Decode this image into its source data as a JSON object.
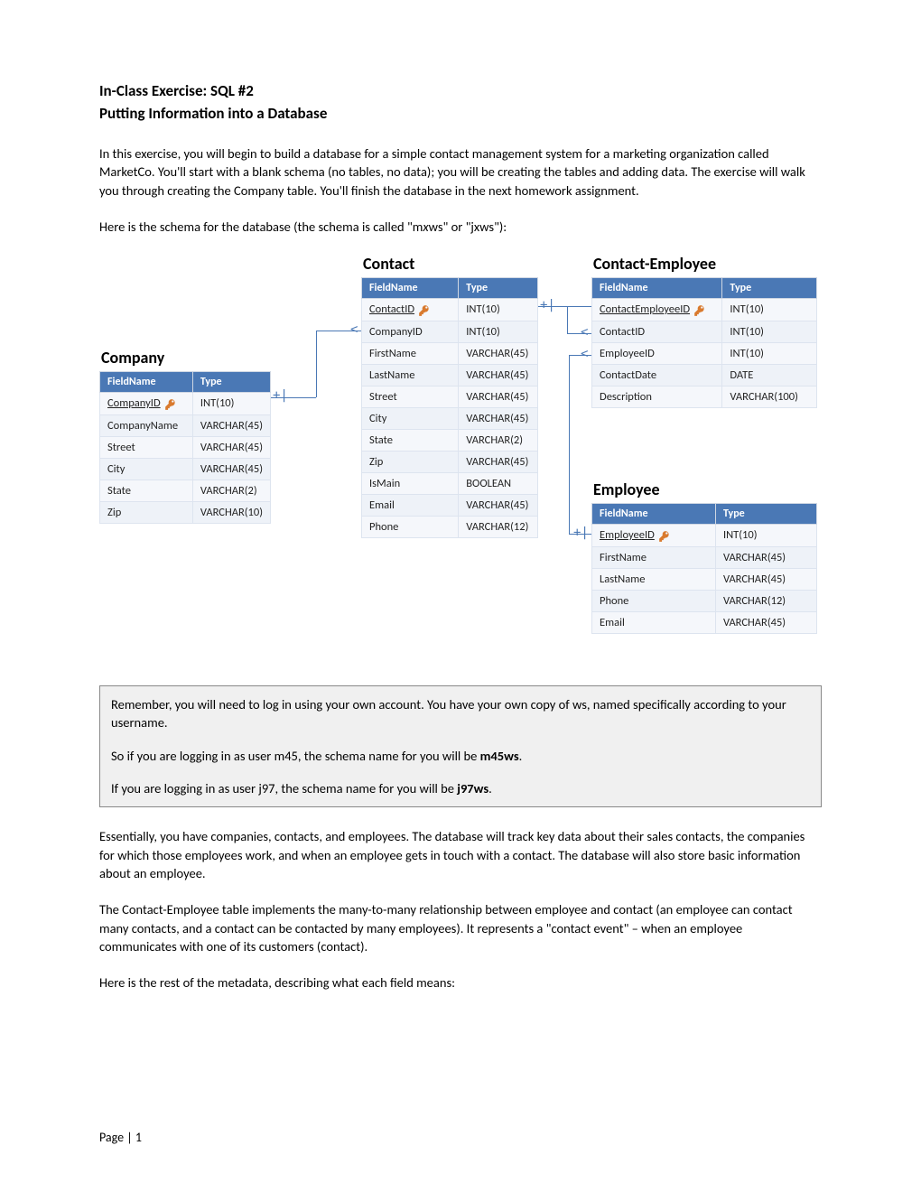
{
  "title": "In-Class Exercise: SQL #2",
  "subtitle": "Putting Information into a Database",
  "intro1": "In this exercise, you will begin to build a database for a simple contact management system for a marketing organization called MarketCo. You'll start with a blank schema (no tables, no data); you will be creating the tables and adding data. The exercise will walk you through creating the Company table. You'll finish the database in the next homework assignment.",
  "schema_lead_a": "Here is the schema for the database (the schema is called \"m",
  "schema_lead_b": "x",
  "schema_lead_c": "ws\" or \"jxws\"):",
  "tables": {
    "company": {
      "title": "Company",
      "headers": [
        "FieldName",
        "Type"
      ],
      "rows": [
        [
          "CompanyID",
          "INT(10)",
          true
        ],
        [
          "CompanyName",
          "VARCHAR(45)",
          false
        ],
        [
          "Street",
          "VARCHAR(45)",
          false
        ],
        [
          "City",
          "VARCHAR(45)",
          false
        ],
        [
          "State",
          "VARCHAR(2)",
          false
        ],
        [
          "Zip",
          "VARCHAR(10)",
          false
        ]
      ]
    },
    "contact": {
      "title": "Contact",
      "headers": [
        "FieldName",
        "Type"
      ],
      "rows": [
        [
          "ContactID",
          "INT(10)",
          true
        ],
        [
          "CompanyID",
          "INT(10)",
          false
        ],
        [
          "FirstName",
          "VARCHAR(45)",
          false
        ],
        [
          "LastName",
          "VARCHAR(45)",
          false
        ],
        [
          "Street",
          "VARCHAR(45)",
          false
        ],
        [
          "City",
          "VARCHAR(45)",
          false
        ],
        [
          "State",
          "VARCHAR(2)",
          false
        ],
        [
          "Zip",
          "VARCHAR(45)",
          false
        ],
        [
          "IsMain",
          "BOOLEAN",
          false
        ],
        [
          "Email",
          "VARCHAR(45)",
          false
        ],
        [
          "Phone",
          "VARCHAR(12)",
          false
        ]
      ]
    },
    "contact_employee": {
      "title": "Contact-Employee",
      "headers": [
        "FieldName",
        "Type"
      ],
      "rows": [
        [
          "ContactEmployeeID",
          "INT(10)",
          true
        ],
        [
          "ContactID",
          "INT(10)",
          false
        ],
        [
          "EmployeeID",
          "INT(10)",
          false
        ],
        [
          "ContactDate",
          "DATE",
          false
        ],
        [
          "Description",
          "VARCHAR(100)",
          false
        ]
      ]
    },
    "employee": {
      "title": "Employee",
      "headers": [
        "FieldName",
        "Type"
      ],
      "rows": [
        [
          "EmployeeID",
          "INT(10)",
          true
        ],
        [
          "FirstName",
          "VARCHAR(45)",
          false
        ],
        [
          "LastName",
          "VARCHAR(45)",
          false
        ],
        [
          "Phone",
          "VARCHAR(12)",
          false
        ],
        [
          "Email",
          "VARCHAR(45)",
          false
        ]
      ]
    }
  },
  "note": {
    "p1": "Remember, you will need to log in using your own account. You have your own copy of ws, named specifically according to your username.",
    "p2a": "So if you are logging in as user m45, the schema name for you will be ",
    "p2b": "m45ws",
    "p2c": ".",
    "p3a": "If you are logging in as user j97, the schema name for you will be ",
    "p3b": "j97ws",
    "p3c": "."
  },
  "body2": "Essentially, you have companies, contacts, and employees. The database will track key data about their sales contacts, the companies for which those employees work, and when an employee gets in touch with a contact. The database will also store basic information about an employee.",
  "body3": "The Contact-Employee table implements the many-to-many relationship between employee and contact (an employee can contact many contacts, and a contact can be contacted by many employees). It represents a \"contact event\" – when an employee communicates with one of its customers (contact).",
  "body4": "Here is the rest of the metadata, describing what each field means:",
  "footer": "Page | 1"
}
